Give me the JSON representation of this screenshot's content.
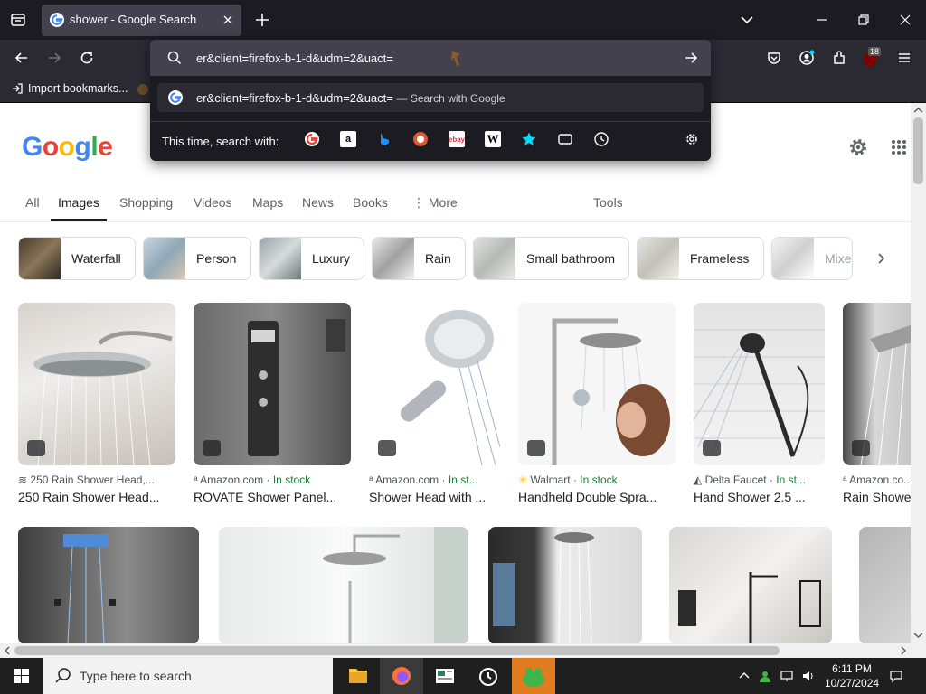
{
  "browser": {
    "tab": {
      "title": "shower - Google Search"
    },
    "url": {
      "value": "er&client=firefox-b-1-d&udm=2&uact="
    },
    "suggestion": {
      "text": "er&client=firefox-b-1-d&udm=2&uact=",
      "hint": "— Search with Google"
    },
    "engines_label": "This time, search with:",
    "engines": [
      "google-icon",
      "amazon-icon",
      "bing-icon",
      "duckduckgo-icon",
      "ebay-icon",
      "wikipedia-icon",
      "bookmarks-star-icon",
      "tabs-icon",
      "history-icon"
    ],
    "bookmarks": [
      {
        "label": "Import bookmarks..."
      }
    ],
    "extensions_badge": "18"
  },
  "google": {
    "logo": [
      "G",
      "o",
      "o",
      "g",
      "l",
      "e"
    ],
    "logo_colors": [
      "#4285F4",
      "#EA4335",
      "#FBBC05",
      "#4285F4",
      "#34A853",
      "#EA4335"
    ],
    "tabs": [
      "All",
      "Images",
      "Shopping",
      "Videos",
      "Maps",
      "News",
      "Books",
      "More",
      "Tools"
    ],
    "active_tab": "Images",
    "chips": [
      "Waterfall",
      "Person",
      "Luxury",
      "Rain",
      "Small bathroom",
      "Frameless",
      "Mixer"
    ],
    "results": [
      {
        "source": "250 Rain Shower Head,...",
        "stock": "",
        "title": "250 Rain Shower Head..."
      },
      {
        "source": "Amazon.com",
        "stock": "· In stock",
        "title": "ROVATE Shower Panel..."
      },
      {
        "source": "Amazon.com",
        "stock": "· In st...",
        "title": "Shower Head with ..."
      },
      {
        "source": "Walmart",
        "stock": "· In stock",
        "title": "Handheld Double Spra..."
      },
      {
        "source": "Delta Faucet",
        "stock": "· In st...",
        "title": "Hand Shower 2.5 ..."
      },
      {
        "source": "Amazon.co...",
        "stock": "",
        "title": "Rain Showe..."
      }
    ]
  },
  "taskbar": {
    "search_placeholder": "Type here to search",
    "time": "6:11 PM",
    "date": "10/27/2024"
  }
}
